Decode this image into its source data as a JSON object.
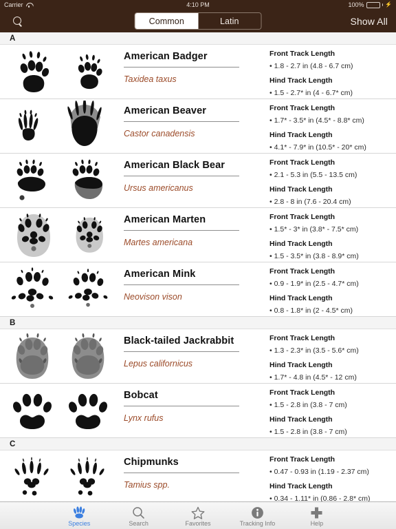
{
  "status_bar": {
    "carrier": "Carrier",
    "wifi_icon": "wifi-icon",
    "time": "4:10 PM",
    "battery_percent": "100%",
    "battery_level": 100,
    "charging_icon": "lightning-bolt-icon"
  },
  "nav_bar": {
    "search_icon": "search-icon",
    "segments": [
      {
        "label": "Common",
        "selected": true
      },
      {
        "label": "Latin",
        "selected": false
      }
    ],
    "show_all_label": "Show All",
    "background_color": "#3b2417"
  },
  "list": {
    "measure_labels": {
      "front": "Front Track Length",
      "hind": "Hind Track Length"
    },
    "sections": [
      {
        "letter": "A",
        "rows": [
          {
            "common_name": "American Badger",
            "latin_name": "Taxidea taxus",
            "front_track_length": "1.8 - 2.7 in (4.8 - 6.7 cm)",
            "hind_track_length": "1.5 - 2.7* in (4 - 6.7* cm)",
            "track_style": "badger"
          },
          {
            "common_name": "American Beaver",
            "latin_name": "Castor canadensis",
            "front_track_length": "1.7* - 3.5* in (4.5* - 8.8* cm)",
            "hind_track_length": "4.1* - 7.9* in (10.5* - 20* cm)",
            "track_style": "beaver"
          },
          {
            "common_name": "American Black Bear",
            "latin_name": "Ursus americanus",
            "front_track_length": "2.1 - 5.3 in (5.5 - 13.5 cm)",
            "hind_track_length": "2.8 - 8 in (7.6 - 20.4 cm)",
            "track_style": "bear"
          },
          {
            "common_name": "American Marten",
            "latin_name": "Martes americana",
            "front_track_length": "1.5* - 3* in (3.8* - 7.5* cm)",
            "hind_track_length": "1.5 - 3.5* in (3.8 - 8.9* cm)",
            "track_style": "marten"
          },
          {
            "common_name": "American Mink",
            "latin_name": "Neovison vison",
            "front_track_length": "0.9 - 1.9* in (2.5 - 4.7* cm)",
            "hind_track_length": "0.8 - 1.8* in (2 - 4.5* cm)",
            "track_style": "mink"
          }
        ]
      },
      {
        "letter": "B",
        "rows": [
          {
            "common_name": "Black-tailed Jackrabbit",
            "latin_name": "Lepus californicus",
            "front_track_length": "1.3 - 2.3* in (3.5 - 5.6* cm)",
            "hind_track_length": "1.7* - 4.8 in (4.5* - 12 cm)",
            "track_style": "jackrabbit"
          },
          {
            "common_name": "Bobcat",
            "latin_name": "Lynx rufus",
            "front_track_length": "1.5 - 2.8 in (3.8 - 7 cm)",
            "hind_track_length": "1.5 - 2.8 in (3.8 - 7 cm)",
            "track_style": "bobcat"
          }
        ]
      },
      {
        "letter": "C",
        "rows": [
          {
            "common_name": "Chipmunks",
            "latin_name": "Tamius spp.",
            "front_track_length": "0.47 - 0.93 in (1.19 - 2.37 cm)",
            "hind_track_length": "0.34 - 1.11* in (0.86 - 2.8* cm)",
            "track_style": "chipmunk"
          }
        ]
      }
    ]
  },
  "tab_bar": {
    "tabs": [
      {
        "label": "Species",
        "icon": "paw-print-icon",
        "active": true
      },
      {
        "label": "Search",
        "icon": "magnifier-icon",
        "active": false
      },
      {
        "label": "Favorites",
        "icon": "star-icon",
        "active": false
      },
      {
        "label": "Tracking Info",
        "icon": "info-circle-icon",
        "active": false
      },
      {
        "label": "Help",
        "icon": "plus-cross-icon",
        "active": false
      }
    ],
    "active_color": "#3b7fe0",
    "inactive_color": "#7b7b7b"
  }
}
